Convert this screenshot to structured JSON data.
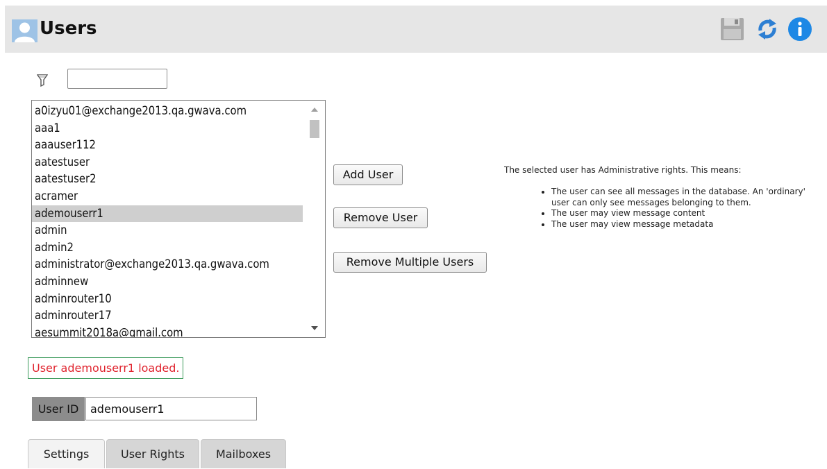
{
  "header": {
    "title": "Users",
    "icons": [
      "user-avatar-icon",
      "save-icon",
      "refresh-icon",
      "info-icon"
    ],
    "colors": {
      "background": "#e6e6e6",
      "refresh": "#2d7fd3",
      "info": "#1e88e5"
    }
  },
  "filter": {
    "icon": "filter-icon",
    "value": ""
  },
  "user_list": {
    "items": [
      "a0izyu01@exchange2013.qa.gwava.com",
      "aaa1",
      "aaauser112",
      "aatestuser",
      "aatestuser2",
      "acramer",
      "ademouserr1",
      "admin",
      "admin2",
      "administrator@exchange2013.qa.gwava.com",
      "adminnew",
      "adminrouter10",
      "adminrouter17",
      "aesummit2018a@gmail.com"
    ],
    "selected": "ademouserr1",
    "selected_index": 6
  },
  "buttons": {
    "add": "Add User",
    "remove": "Remove User",
    "remove_multiple": "Remove Multiple Users"
  },
  "info": {
    "heading": "The selected user has Administrative rights. This means:",
    "bullets": [
      "The user can see all messages in the database. An 'ordinary' user can only see messages belonging to them.",
      "The user may view message content",
      "The user may view message metadata"
    ]
  },
  "status": {
    "text": "User ademouserr1 loaded.",
    "color": "#e0242e",
    "border_color": "#3a9a5a"
  },
  "user_id": {
    "label": "User ID",
    "value": "ademouserr1"
  },
  "tabs": [
    {
      "label": "Settings",
      "active": true
    },
    {
      "label": "User Rights",
      "active": false
    },
    {
      "label": "Mailboxes",
      "active": false
    }
  ]
}
